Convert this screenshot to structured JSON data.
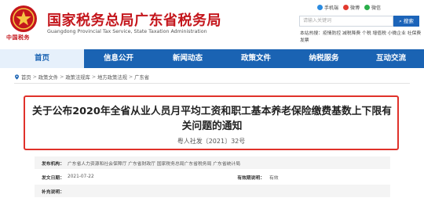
{
  "header": {
    "site_title": "国家税务总局广东省税务局",
    "site_subtitle": "Guangdong Provincial Tax Service, State Taxation Administration",
    "emblem_text": "中国税务",
    "colors": {
      "brand_red": "#c4161c",
      "nav_blue": "#1a63b3"
    }
  },
  "quick_links": [
    {
      "label": "手机端",
      "icon": "mobile-icon",
      "color": "#2b8be0"
    },
    {
      "label": "微博",
      "icon": "weibo-icon",
      "color": "#e23a2e"
    },
    {
      "label": "微信",
      "icon": "wechat-icon",
      "color": "#2aae4a"
    }
  ],
  "search": {
    "placeholder": "请输入关键词",
    "button_label": "搜索"
  },
  "hot_search": "本站热搜：疫情防控 减税降费 个税 增值税 小微企业 社保费 发票",
  "nav": {
    "items": [
      {
        "label": "首页"
      },
      {
        "label": "信息公开"
      },
      {
        "label": "新闻动态"
      },
      {
        "label": "政策文件"
      },
      {
        "label": "纳税服务"
      },
      {
        "label": "互动交流"
      }
    ]
  },
  "breadcrumb": {
    "items": [
      "首页",
      "政策文件",
      "政策法规库",
      "地方政策法规",
      "广东省"
    ],
    "separator": ">"
  },
  "article": {
    "title": "关于公布2020年全省从业人员月平均工资和职工基本养老保险缴费基数上下限有关问题的通知",
    "doc_number": "粤人社发〔2021〕32号"
  },
  "meta": {
    "issuer_label": "发布机构：",
    "issuer_value": "广东省人力资源和社会保障厅 广东省财政厅 国家税务总局广东省税务局 广东省统计局",
    "date_label": "发文日期：",
    "date_value": "2021-07-22",
    "validity_label": "有效期说明：",
    "validity_value": "有效",
    "supplement_label": "补充说明：",
    "supplement_value": ""
  }
}
